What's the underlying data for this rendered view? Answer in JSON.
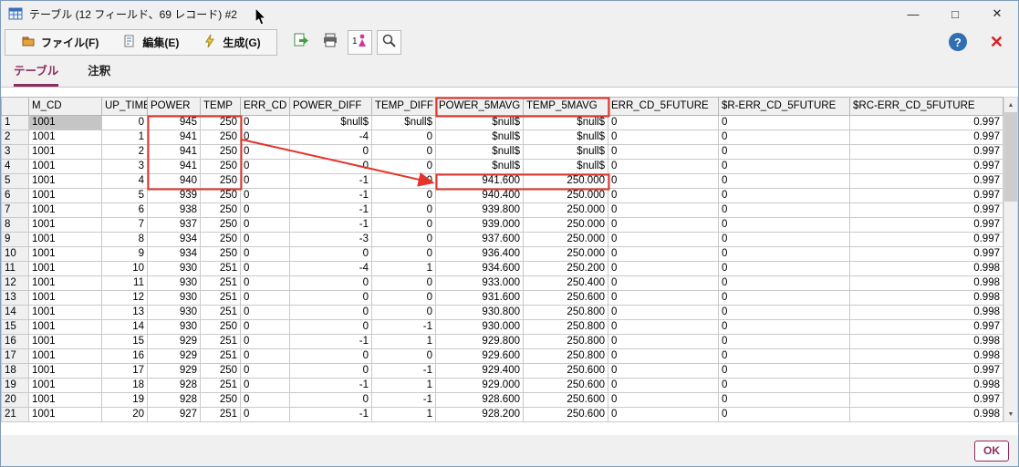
{
  "window": {
    "title": "テーブル (12 フィールド、69 レコード) #2",
    "controls": {
      "minimize": "—",
      "maximize": "□",
      "close": "✕"
    }
  },
  "toolbar": {
    "menus": [
      {
        "label": "ファイル(F)"
      },
      {
        "label": "編集(E)"
      },
      {
        "label": "生成(G)"
      }
    ],
    "help_label": "?",
    "close_label": "✕"
  },
  "tabs": [
    {
      "label": "テーブル",
      "active": true
    },
    {
      "label": "注釈",
      "active": false
    }
  ],
  "scrollbar": {
    "up": "▲",
    "down": "▼"
  },
  "table": {
    "columns": [
      "M_CD",
      "UP_TIME",
      "POWER",
      "TEMP",
      "ERR_CD",
      "POWER_DIFF",
      "TEMP_DIFF",
      "POWER_5MAVG",
      "TEMP_5MAVG",
      "ERR_CD_5FUTURE",
      "$R-ERR_CD_5FUTURE",
      "$RC-ERR_CD_5FUTURE"
    ],
    "align": [
      "left",
      "right",
      "right",
      "right",
      "left",
      "right",
      "right",
      "right",
      "right",
      "left",
      "left",
      "right"
    ],
    "start_index": 1,
    "selected_cell": {
      "row": 0,
      "col": 0
    },
    "rows": [
      [
        "1001",
        "0",
        "945",
        "250",
        "0",
        "$null$",
        "$null$",
        "$null$",
        "$null$",
        "0",
        "0",
        "0.997"
      ],
      [
        "1001",
        "1",
        "941",
        "250",
        "0",
        "-4",
        "0",
        "$null$",
        "$null$",
        "0",
        "0",
        "0.997"
      ],
      [
        "1001",
        "2",
        "941",
        "250",
        "0",
        "0",
        "0",
        "$null$",
        "$null$",
        "0",
        "0",
        "0.997"
      ],
      [
        "1001",
        "3",
        "941",
        "250",
        "0",
        "0",
        "0",
        "$null$",
        "$null$",
        "0",
        "0",
        "0.997"
      ],
      [
        "1001",
        "4",
        "940",
        "250",
        "0",
        "-1",
        "0",
        "941.600",
        "250.000",
        "0",
        "0",
        "0.997"
      ],
      [
        "1001",
        "5",
        "939",
        "250",
        "0",
        "-1",
        "0",
        "940.400",
        "250.000",
        "0",
        "0",
        "0.997"
      ],
      [
        "1001",
        "6",
        "938",
        "250",
        "0",
        "-1",
        "0",
        "939.800",
        "250.000",
        "0",
        "0",
        "0.997"
      ],
      [
        "1001",
        "7",
        "937",
        "250",
        "0",
        "-1",
        "0",
        "939.000",
        "250.000",
        "0",
        "0",
        "0.997"
      ],
      [
        "1001",
        "8",
        "934",
        "250",
        "0",
        "-3",
        "0",
        "937.600",
        "250.000",
        "0",
        "0",
        "0.997"
      ],
      [
        "1001",
        "9",
        "934",
        "250",
        "0",
        "0",
        "0",
        "936.400",
        "250.000",
        "0",
        "0",
        "0.997"
      ],
      [
        "1001",
        "10",
        "930",
        "251",
        "0",
        "-4",
        "1",
        "934.600",
        "250.200",
        "0",
        "0",
        "0.998"
      ],
      [
        "1001",
        "11",
        "930",
        "251",
        "0",
        "0",
        "0",
        "933.000",
        "250.400",
        "0",
        "0",
        "0.998"
      ],
      [
        "1001",
        "12",
        "930",
        "251",
        "0",
        "0",
        "0",
        "931.600",
        "250.600",
        "0",
        "0",
        "0.998"
      ],
      [
        "1001",
        "13",
        "930",
        "251",
        "0",
        "0",
        "0",
        "930.800",
        "250.800",
        "0",
        "0",
        "0.998"
      ],
      [
        "1001",
        "14",
        "930",
        "250",
        "0",
        "0",
        "-1",
        "930.000",
        "250.800",
        "0",
        "0",
        "0.997"
      ],
      [
        "1001",
        "15",
        "929",
        "251",
        "0",
        "-1",
        "1",
        "929.800",
        "250.800",
        "0",
        "0",
        "0.998"
      ],
      [
        "1001",
        "16",
        "929",
        "251",
        "0",
        "0",
        "0",
        "929.600",
        "250.800",
        "0",
        "0",
        "0.998"
      ],
      [
        "1001",
        "17",
        "929",
        "250",
        "0",
        "0",
        "-1",
        "929.400",
        "250.600",
        "0",
        "0",
        "0.997"
      ],
      [
        "1001",
        "18",
        "928",
        "251",
        "0",
        "-1",
        "1",
        "929.000",
        "250.600",
        "0",
        "0",
        "0.998"
      ],
      [
        "1001",
        "19",
        "928",
        "250",
        "0",
        "0",
        "-1",
        "928.600",
        "250.600",
        "0",
        "0",
        "0.997"
      ],
      [
        "1001",
        "20",
        "927",
        "251",
        "0",
        "-1",
        "1",
        "928.200",
        "250.600",
        "0",
        "0",
        "0.998"
      ]
    ]
  },
  "annotations": {
    "boxes": [
      {
        "target": "cells",
        "row_start": 0,
        "row_end": 4,
        "col_start": 2,
        "col_end": 3
      },
      {
        "target": "header",
        "col_start": 7,
        "col_end": 8
      },
      {
        "target": "cells",
        "row_start": 4,
        "row_end": 4,
        "col_start": 7,
        "col_end": 8
      }
    ],
    "arrow": {
      "from_box": 0,
      "to_box": 2
    }
  },
  "footer": {
    "ok_label": "OK"
  },
  "colors": {
    "annotation_red": "#e2342b",
    "tab_accent": "#8d2c5e",
    "help_blue": "#2f6fb2",
    "close_red": "#d81e1e"
  }
}
